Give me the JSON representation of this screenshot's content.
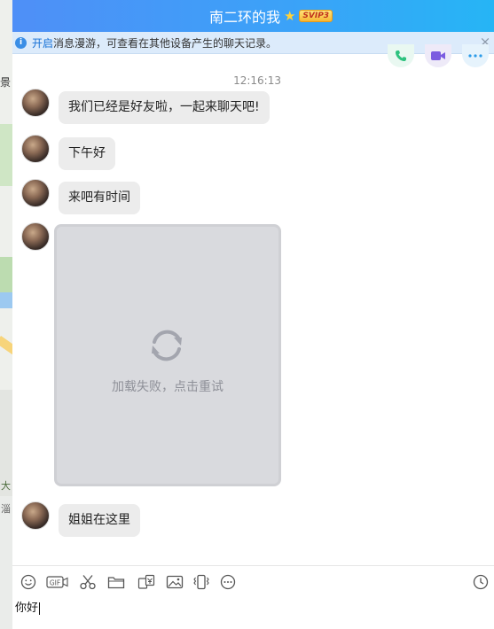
{
  "background": {
    "map_labels": [
      "景",
      "大",
      "淄"
    ]
  },
  "header": {
    "title": "南二环的我",
    "badge_icon": "star-icon",
    "vip_label": "SVIP3"
  },
  "notice": {
    "link_text": "开启",
    "text": "消息漫游，可查看在其他设备产生的聊天记录。",
    "close_label": "×"
  },
  "actions": [
    "phone-call-icon",
    "video-call-icon",
    "more-icon"
  ],
  "timestamp": "12:16:13",
  "messages": [
    {
      "type": "text",
      "text": "我们已经是好友啦，一起来聊天吧!"
    },
    {
      "type": "text",
      "text": "下午好"
    },
    {
      "type": "text",
      "text": "来吧有时间"
    },
    {
      "type": "image",
      "status_text": "加载失败，点击重试"
    },
    {
      "type": "text",
      "text": "姐姐在这里"
    }
  ],
  "toolbar": {
    "tools": [
      "emoji-icon",
      "gif-icon",
      "screenshot-scissors-icon",
      "folder-icon",
      "red-packet-icon",
      "image-icon",
      "shake-icon",
      "more-options-icon"
    ],
    "gif_label": "GIF",
    "history_icon": "clock-icon"
  },
  "input": {
    "value": "你好"
  },
  "colors": {
    "title_gradient_start": "#4f8ff7",
    "title_gradient_end": "#26b5f5",
    "notice_bg": "#dcebfb",
    "bubble_bg": "#ececec",
    "link": "#1570d6"
  }
}
